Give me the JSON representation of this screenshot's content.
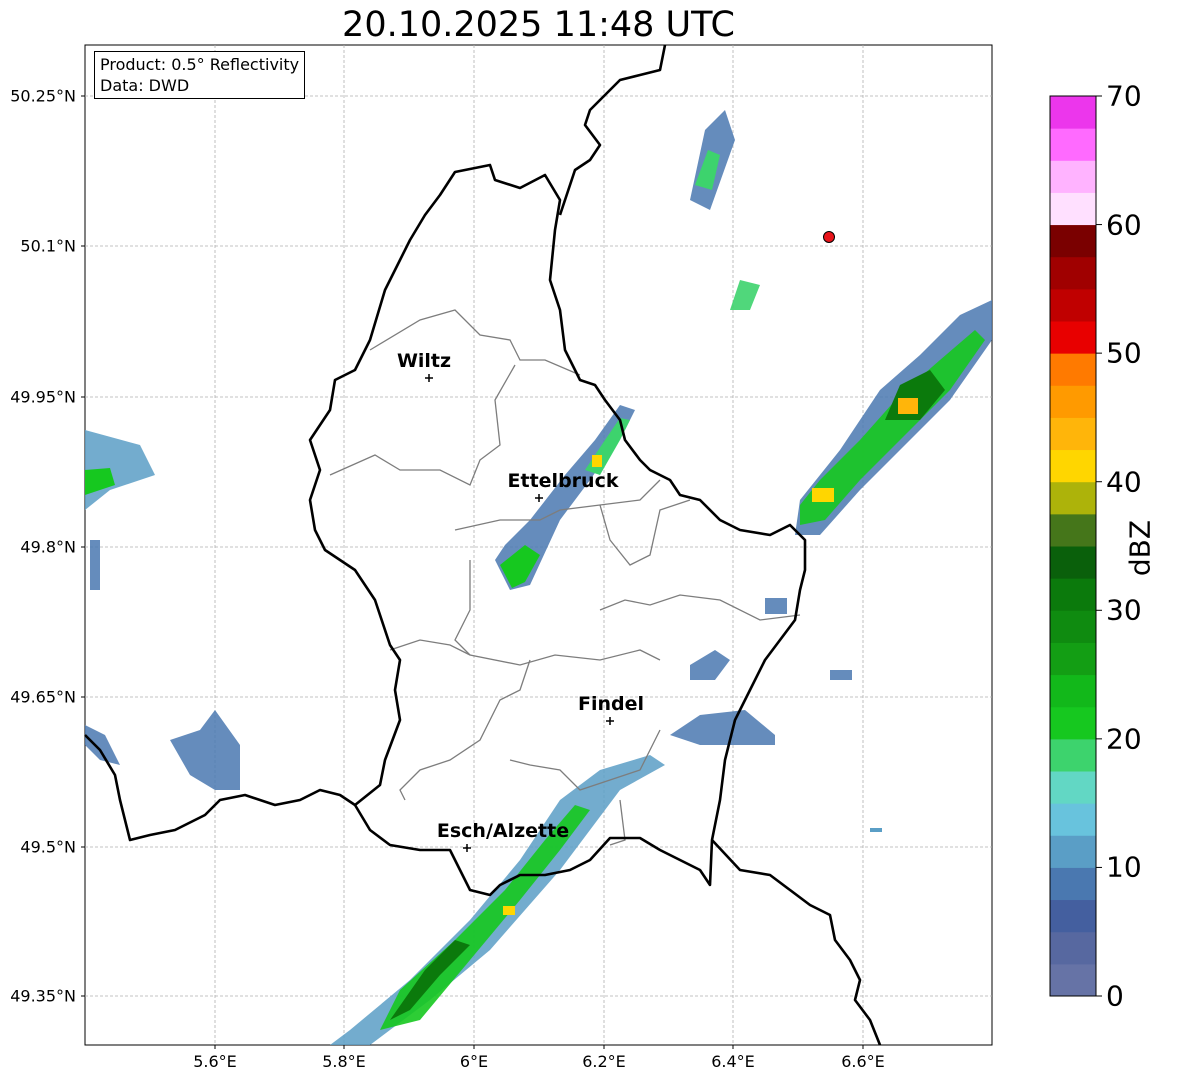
{
  "title": "20.10.2025 11:48 UTC",
  "info": {
    "product": "Product: 0.5° Reflectivity",
    "data": "Data: DWD"
  },
  "lat_labels": [
    "50.25°N",
    "50.1°N",
    "49.95°N",
    "49.8°N",
    "49.65°N",
    "49.5°N",
    "49.35°N"
  ],
  "lon_labels": [
    "5.6°E",
    "5.8°E",
    "6°E",
    "6.2°E",
    "6.4°E",
    "6.6°E"
  ],
  "cities": [
    {
      "name": "Wiltz",
      "lon": 5.93,
      "lat": 49.97
    },
    {
      "name": "Ettelbruck",
      "lon": 6.1,
      "lat": 49.85
    },
    {
      "name": "Findel",
      "lon": 6.21,
      "lat": 49.63
    },
    {
      "name": "Esch/Alzette",
      "lon": 5.99,
      "lat": 49.5
    }
  ],
  "radar_site": {
    "lon": 6.55,
    "lat": 50.11,
    "color": "#e8141b"
  },
  "colorbar": {
    "label": "dBZ",
    "min": 0,
    "max": 70,
    "step": 2.5,
    "tick_labels": [
      "0",
      "10",
      "20",
      "30",
      "40",
      "50",
      "60",
      "70"
    ],
    "colors": [
      "#6673a6",
      "#5768a0",
      "#445f9f",
      "#4a78b0",
      "#5a9ec6",
      "#68c3dd",
      "#62d7c4",
      "#3dd36d",
      "#16c81f",
      "#12b81a",
      "#139e14",
      "#0f8b10",
      "#0b7a0c",
      "#0a600b",
      "#45761a",
      "#adb30a",
      "#ffd600",
      "#ffb50a",
      "#ff9a00",
      "#ff7a00",
      "#e80000",
      "#c00000",
      "#a00000",
      "#7a0000",
      "#ffe0ff",
      "#ffb3ff",
      "#ff6aff",
      "#ec36ec"
    ]
  }
}
